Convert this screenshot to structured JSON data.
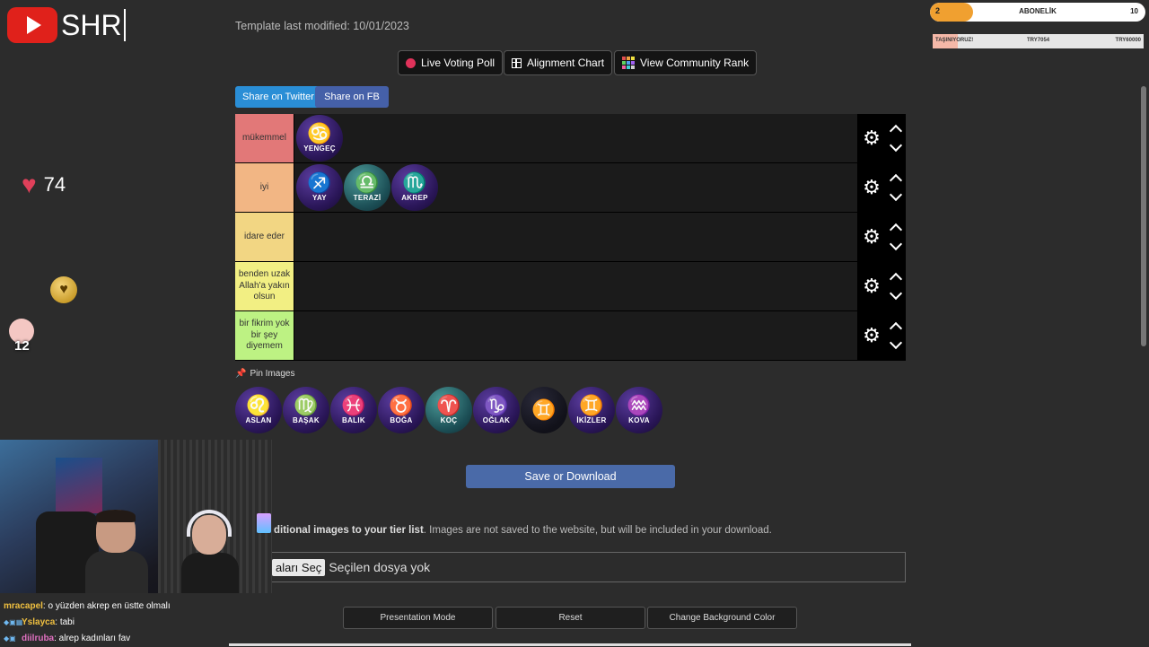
{
  "stream": {
    "logo_text": "SHR",
    "heart_count": "74",
    "sticker_number": "12"
  },
  "overlay": {
    "subscriber_goal": {
      "current": "2",
      "label": "ABONELİK",
      "target": "10",
      "progress": 0.2
    },
    "ticker": {
      "left": "TAŞINIYORUZ!",
      "mid": "TRY7054",
      "right": "TRY60000",
      "progress": 0.118
    }
  },
  "page": {
    "template_modified": "Template last modified: 10/01/2023",
    "buttons": {
      "live_poll": "Live Voting Poll",
      "alignment_chart": "Alignment Chart",
      "community_rank": "View Community Rank"
    },
    "share": {
      "twitter": "Share on Twitter",
      "facebook": "Share on FB"
    },
    "colors": {
      "twitter": "#2a8ed6",
      "facebook": "#4560a8",
      "save": "#4a6aa8"
    },
    "tiers": [
      {
        "label": "mükemmel",
        "color": "#e27878",
        "items": [
          {
            "glyph": "♋",
            "name": "YENGEÇ",
            "style": "purple"
          }
        ]
      },
      {
        "label": "iyi",
        "color": "#f2b684",
        "items": [
          {
            "glyph": "♐",
            "name": "YAY",
            "style": "purple"
          },
          {
            "glyph": "♎",
            "name": "TERAZİ",
            "style": "teal"
          },
          {
            "glyph": "♏",
            "name": "AKREP",
            "style": "purple"
          }
        ]
      },
      {
        "label": "idare eder",
        "color": "#f2d683",
        "items": []
      },
      {
        "label": "benden uzak Allah'a yakın olsun",
        "color": "#f2ef83",
        "items": []
      },
      {
        "label": "bir fikrim yok bir şey diyemem",
        "color": "#bdf283",
        "items": []
      }
    ],
    "pin_images": "Pin Images",
    "pool": [
      {
        "glyph": "♌",
        "name": "ASLAN",
        "style": "purple"
      },
      {
        "glyph": "♍",
        "name": "BAŞAK",
        "style": "purple"
      },
      {
        "glyph": "♓",
        "name": "BALIK",
        "style": "purple"
      },
      {
        "glyph": "♉",
        "name": "BOĞA",
        "style": "purple"
      },
      {
        "glyph": "♈",
        "name": "KOÇ",
        "style": "teal"
      },
      {
        "glyph": "♑",
        "name": "OĞLAK",
        "style": "purple"
      },
      {
        "glyph": "♊",
        "name": "",
        "style": "dark"
      },
      {
        "glyph": "♊",
        "name": "İKİZLER",
        "style": "purple"
      },
      {
        "glyph": "♒",
        "name": "KOVA",
        "style": "purple"
      }
    ],
    "save_download": "Save or Download",
    "add_images_bold": "ditional images to your tier list",
    "add_images_rest": ". Images are not saved to the website, but will be included in your download.",
    "file_button": "aları Seç",
    "file_status": "Seçilen dosya yok",
    "bottom_buttons": {
      "presentation": "Presentation Mode",
      "reset": "Reset",
      "background": "Change Background Color"
    }
  },
  "chat": [
    {
      "user": "mracapel",
      "color": "#f0c040",
      "message": ": o yüzden akrep en üstte olmalı",
      "badges": ""
    },
    {
      "user": "Yslayca",
      "color": "#f0c040",
      "message": ": tabi",
      "badges": "◆▣▦"
    },
    {
      "user": "diilruba",
      "color": "#e070c0",
      "message": ": alrep kadınları fav",
      "badges": "◆▣"
    }
  ]
}
